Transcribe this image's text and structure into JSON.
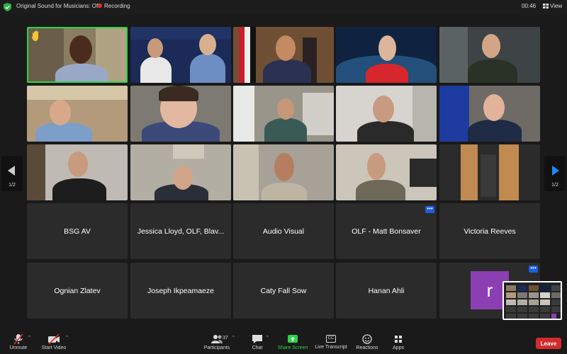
{
  "topbar": {
    "original_sound": "Original Sound for Musicians: Off",
    "recording": "Recording",
    "timer": "00:46",
    "view": "View"
  },
  "pager": {
    "left": "1/2",
    "right": "1/2"
  },
  "name_tiles": [
    "BSG AV",
    "Jessica Lloyd, OLF, Blav...",
    "Audio Visual",
    "OLF - Matt Bonsaver",
    "Victoria Reeves",
    "Ognian Zlatev",
    "Joseph Ikpeamaeze",
    "Caty Fall Sow",
    "Hanan Ahli"
  ],
  "avatar_letter": "r",
  "more_label": "•••",
  "toolbar": {
    "unmute": "Unmute",
    "start_video": "Start Video",
    "participants": "Participants",
    "participants_count": "37",
    "chat": "Chat",
    "share_screen": "Share Screen",
    "live_transcript": "Live Transcript",
    "reactions": "Reactions",
    "apps": "Apps",
    "leave": "Leave",
    "cc": "CC"
  },
  "colors": {
    "share_green": "#2fd24a",
    "leave_red": "#d22b2b",
    "avatar_purple": "#8b3fb3",
    "more_blue": "#1a5fe0",
    "active_speaker": "#2fd24a"
  },
  "icons": [
    "shield-icon",
    "recording-dot-icon",
    "view-grid-icon",
    "hand-raise-icon",
    "mic-muted-icon",
    "video-off-icon",
    "participants-icon",
    "chat-icon",
    "share-screen-icon",
    "cc-icon",
    "reactions-icon",
    "apps-icon"
  ]
}
